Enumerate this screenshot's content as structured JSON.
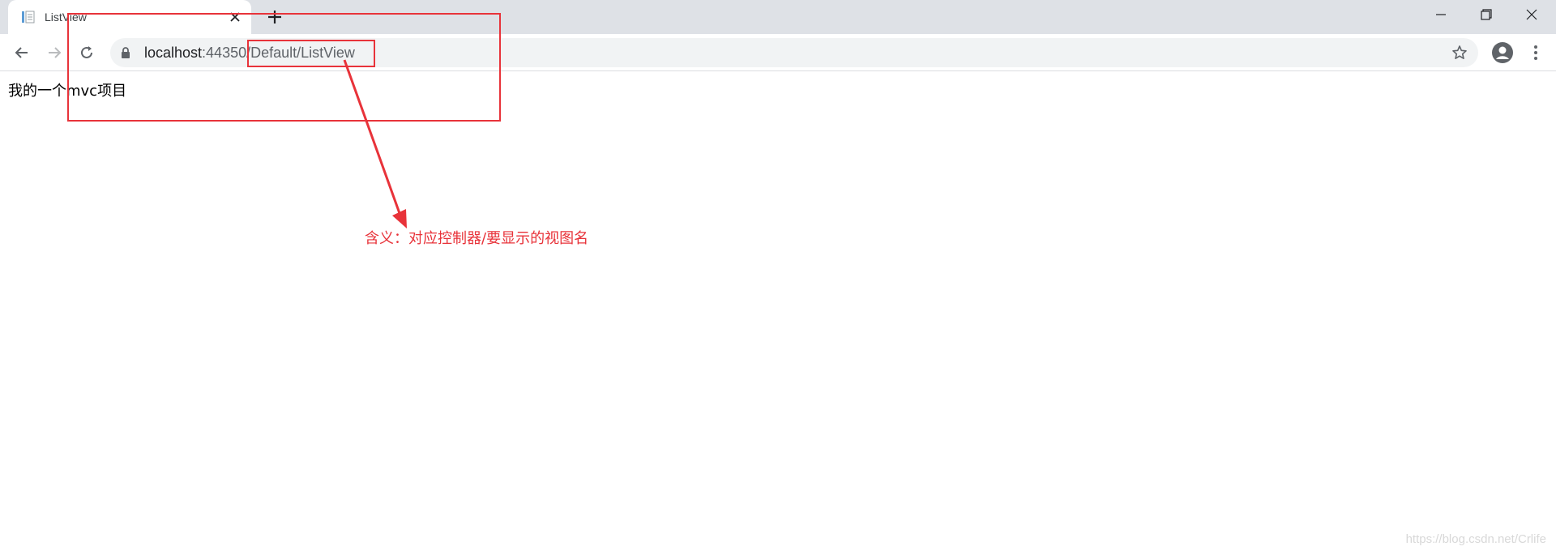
{
  "tab": {
    "title": "ListView",
    "close_icon": "close-icon",
    "new_tab_icon": "plus-icon"
  },
  "window": {
    "minimize_icon": "minimize-icon",
    "restore_icon": "restore-icon",
    "close_icon": "close-icon"
  },
  "toolbar": {
    "back_icon": "arrow-left-icon",
    "forward_icon": "arrow-right-icon",
    "reload_icon": "reload-icon",
    "url_host": "localhost",
    "url_rest": ":44350/Default/ListView",
    "bookmark_icon": "star-icon",
    "profile_icon": "account-circle-icon",
    "menu_icon": "kebab-menu-icon"
  },
  "page": {
    "body_text": "我的一个mvc项目"
  },
  "annotation": {
    "text": "含义：对应控制器/要显示的视图名",
    "color": "#e8333a"
  },
  "watermark": "https://blog.csdn.net/Crlife"
}
